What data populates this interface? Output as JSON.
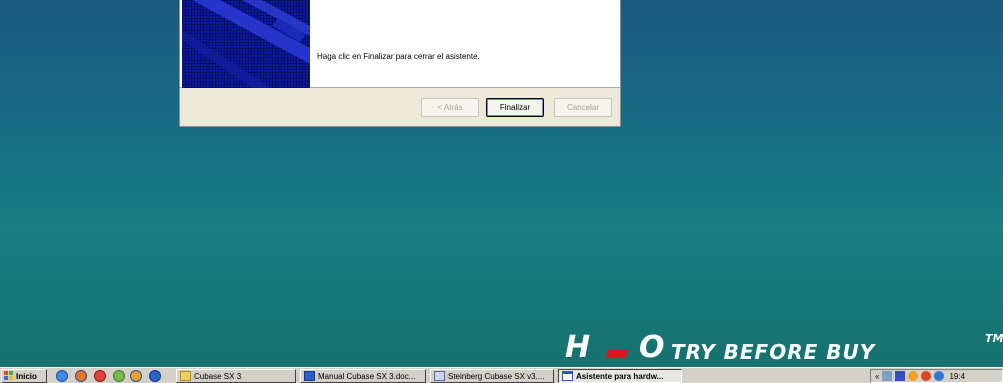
{
  "dialog": {
    "finish_text": "Haga clic en Finalizar para cerrar el asistente.",
    "back_label": "< Atrás",
    "finish_label": "Finalizar",
    "cancel_label": "Cancelar"
  },
  "watermark": {
    "logo_h": "H",
    "logo_o": "O",
    "tagline": "TRY BEFORE BUY",
    "tm": "TM"
  },
  "taskbar": {
    "start_label": "Inicio",
    "tasks": [
      {
        "label": "Cubase SX 3",
        "icon": "folder-icon"
      },
      {
        "label": "Manual Cubase SX 3.doc...",
        "icon": "word-document-icon"
      },
      {
        "label": "Steinberg Cubase SX v3....",
        "icon": "application-icon"
      },
      {
        "label": "Asistente para hardw...",
        "icon": "wizard-window-icon",
        "active": true
      }
    ],
    "tray_chevron": "«",
    "clock": "19:4"
  },
  "colors": {
    "desktop_top": "#1a5a82",
    "desktop_bottom": "#15706c",
    "wizard_art": "#0c1aa8",
    "watermark_accent": "#e0141a"
  }
}
